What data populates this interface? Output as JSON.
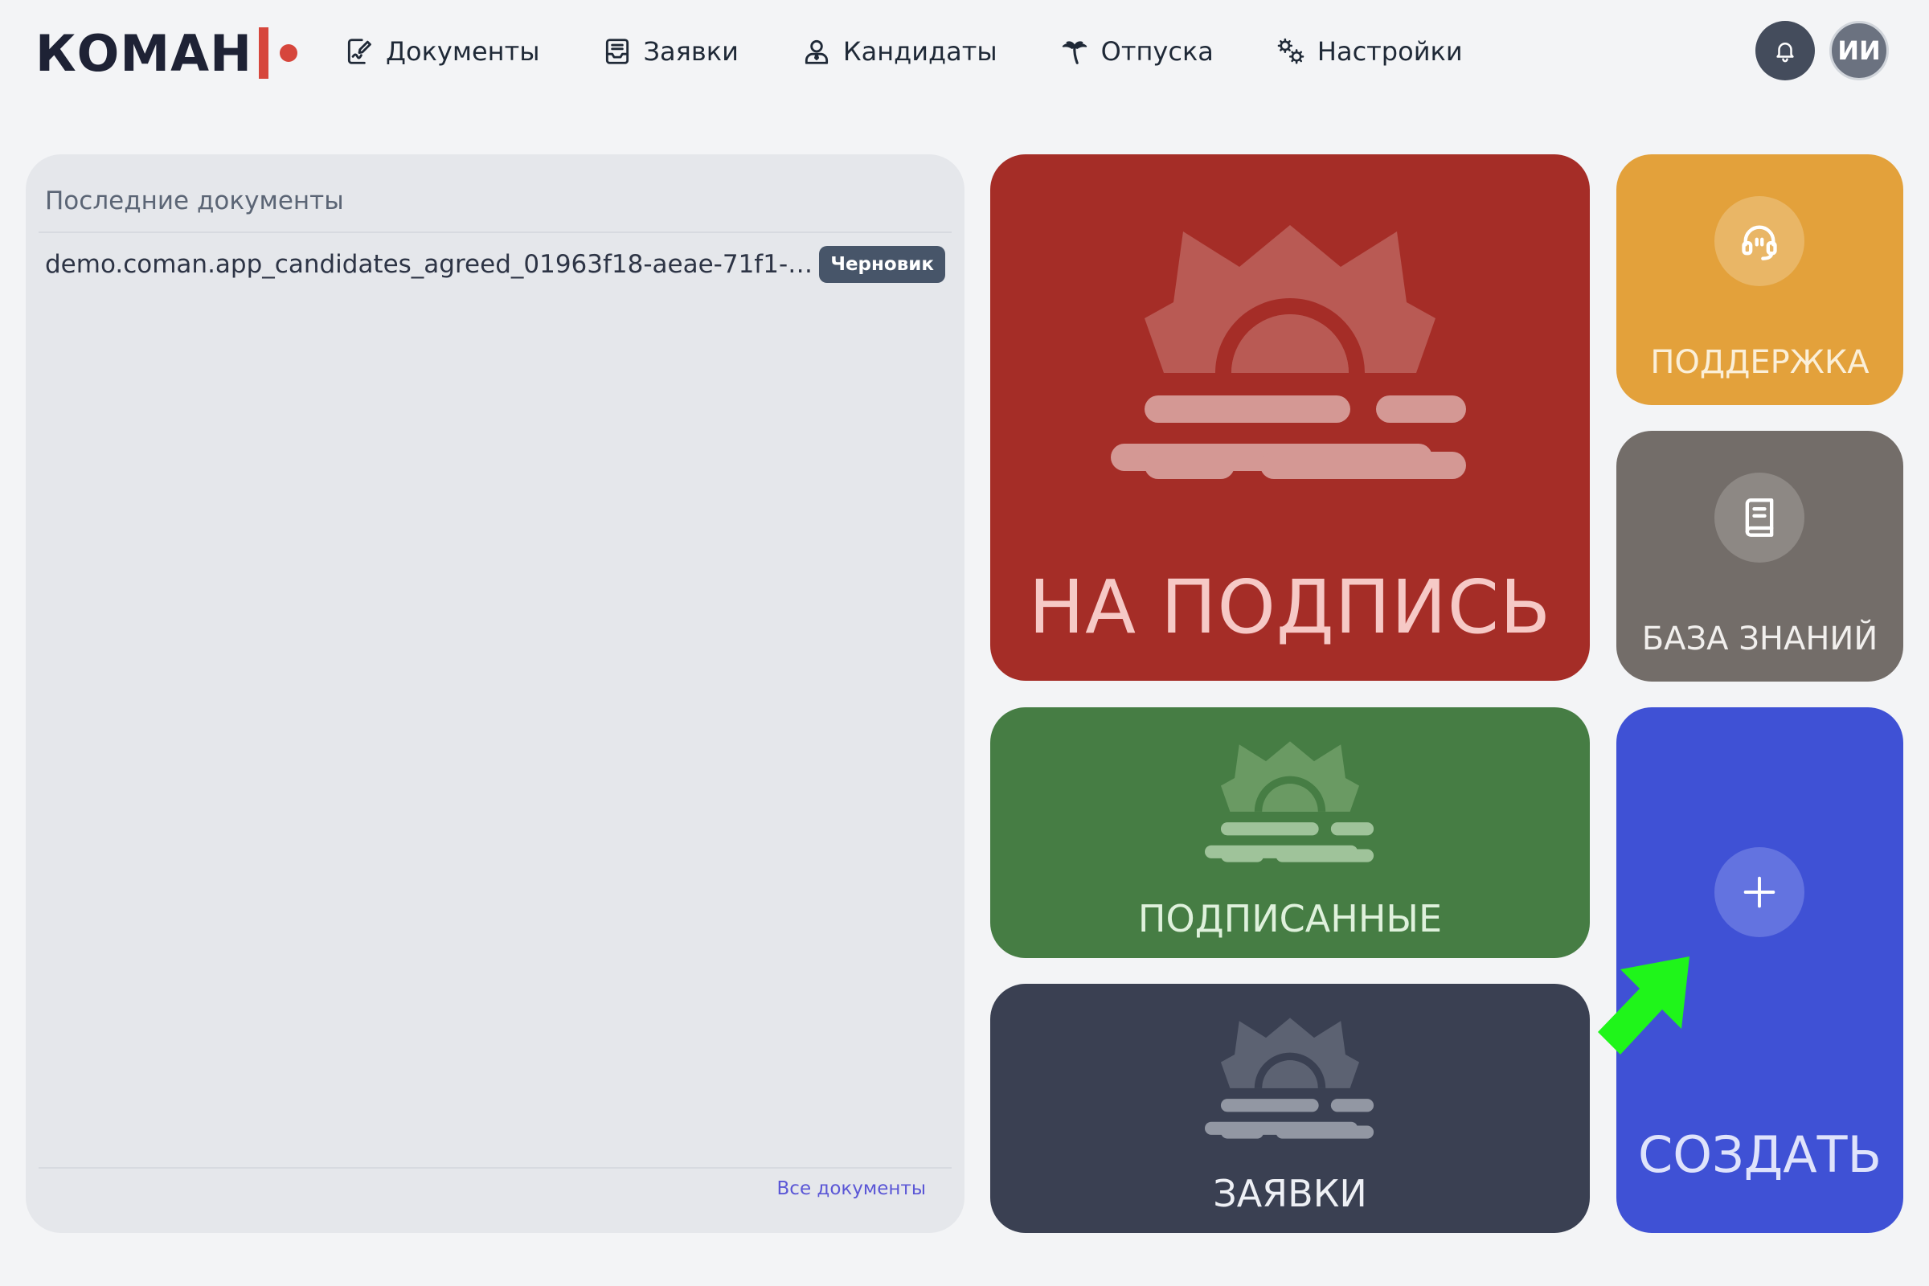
{
  "app": {
    "logo_text": "КОМАН"
  },
  "nav": {
    "items": [
      {
        "label": "Документы",
        "icon": "document-sign-icon"
      },
      {
        "label": "Заявки",
        "icon": "inbox-icon"
      },
      {
        "label": "Кандидаты",
        "icon": "user-icon"
      },
      {
        "label": "Отпуска",
        "icon": "palm-tree-icon"
      },
      {
        "label": "Настройки",
        "icon": "gears-icon"
      }
    ]
  },
  "user": {
    "initials": "ИИ"
  },
  "recent_docs": {
    "title": "Последние документы",
    "items": [
      {
        "name": "demo.coman.app_candidates_agreed_01963f18-aeae-71f1-bb40-…",
        "status": "Черновик"
      }
    ],
    "all_link": "Все документы"
  },
  "tiles": {
    "to_sign": {
      "label": "НА ПОДПИСЬ",
      "color": "#a52d27"
    },
    "signed": {
      "label": "ПОДПИСАННЫЕ",
      "color": "#467d44"
    },
    "requests": {
      "label": "ЗАЯВКИ",
      "color": "#3a4052"
    },
    "support": {
      "label": "ПОДДЕРЖКА",
      "color": "#e3a13b",
      "icon": "headset-icon"
    },
    "knowledge_base": {
      "label": "БАЗА ЗНАНИЙ",
      "color": "#736d69",
      "icon": "book-icon"
    },
    "create": {
      "label": "СОЗДАТЬ",
      "color": "#3f51d5",
      "icon": "plus-icon"
    }
  }
}
